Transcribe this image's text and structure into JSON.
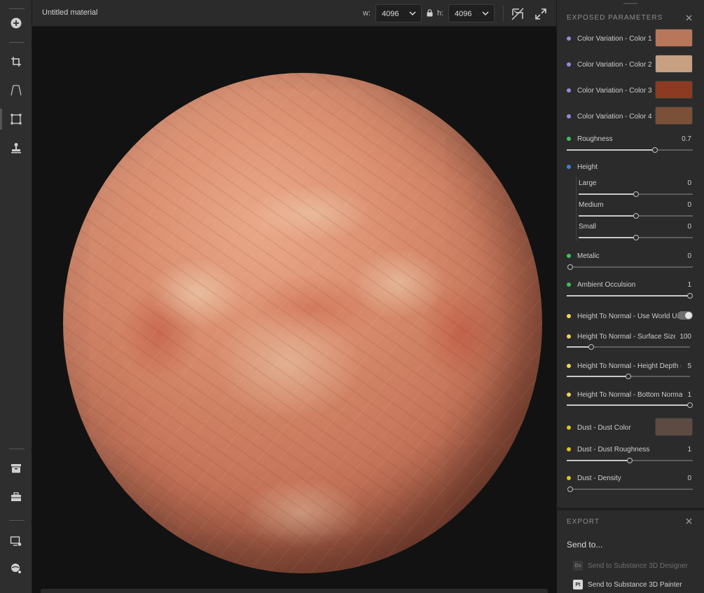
{
  "header": {
    "title": "Untitled material",
    "width_label": "w:",
    "width_value": "4096",
    "height_label": "h:",
    "height_value": "4096"
  },
  "toolbar": {
    "icons": [
      "add-icon",
      "crop-icon",
      "perspective-icon",
      "transform-icon",
      "stamp-icon",
      "archive-icon",
      "toolbox-icon",
      "display-settings-icon",
      "environment-settings-icon"
    ]
  },
  "parameters": {
    "section_title": "EXPOSED PARAMETERS",
    "colors": [
      {
        "label": "Color Variation - Color 1",
        "swatch": "#b8765a",
        "dot": "#8f8bdd"
      },
      {
        "label": "Color Variation - Color 2",
        "swatch": "#c7a081",
        "dot": "#8f8bdd"
      },
      {
        "label": "Color Variation - Color 3",
        "swatch": "#8c3a22",
        "dot": "#8f8bdd"
      },
      {
        "label": "Color Variation - Color 4",
        "swatch": "#7a5038",
        "dot": "#8f8bdd"
      }
    ],
    "roughness": {
      "label": "Roughness",
      "value": "0.7",
      "fraction": 0.7,
      "dot": "#3fbf5a"
    },
    "height": {
      "label": "Height",
      "dot": "#3d7fd9",
      "large": {
        "label": "Large",
        "value": "0",
        "fraction": 0.5
      },
      "medium": {
        "label": "Medium",
        "value": "0",
        "fraction": 0.5
      },
      "small": {
        "label": "Small",
        "value": "0",
        "fraction": 0.5
      }
    },
    "metalic": {
      "label": "Metalic",
      "value": "0",
      "fraction": 0.0,
      "dot": "#3fbf5a"
    },
    "ambient_occlusion": {
      "label": "Ambient Occulsion",
      "value": "1",
      "fraction": 1.0,
      "dot": "#3fbf5a"
    },
    "htn_world_units": {
      "label": "Height To Normal - Use World Units",
      "dot": "#f1d35a",
      "on": true
    },
    "htn_surface_size": {
      "label": "Height To Normal - Surface Size ...",
      "value": "100",
      "fraction": 0.2,
      "dot": "#f1d35a"
    },
    "htn_height_depth": {
      "label": "Height To Normal - Height Depth (...",
      "value": "5",
      "fraction": 0.5,
      "dot": "#f1d35a"
    },
    "htn_bottom_normal": {
      "label": "Height To Normal - Bottom Normal...",
      "value": "1",
      "fraction": 1.0,
      "dot": "#f1d35a"
    },
    "dust_color": {
      "label": "Dust - Dust Color",
      "swatch": "#5d4a42",
      "dot": "#e0c21e"
    },
    "dust_roughness": {
      "label": "Dust - Dust Roughness",
      "value": "1",
      "fraction": 0.5,
      "dot": "#e0c21e"
    },
    "dust_density": {
      "label": "Dust - Density",
      "value": "0",
      "fraction": 0.0,
      "dot": "#e0c21e"
    }
  },
  "export": {
    "section_title": "EXPORT",
    "send_to": "Send to...",
    "designer": {
      "badge": "Ds",
      "label": "Send to Substance 3D Designer"
    },
    "painter": {
      "badge": "Pt",
      "label": "Send to Substance 3D Painter"
    }
  }
}
